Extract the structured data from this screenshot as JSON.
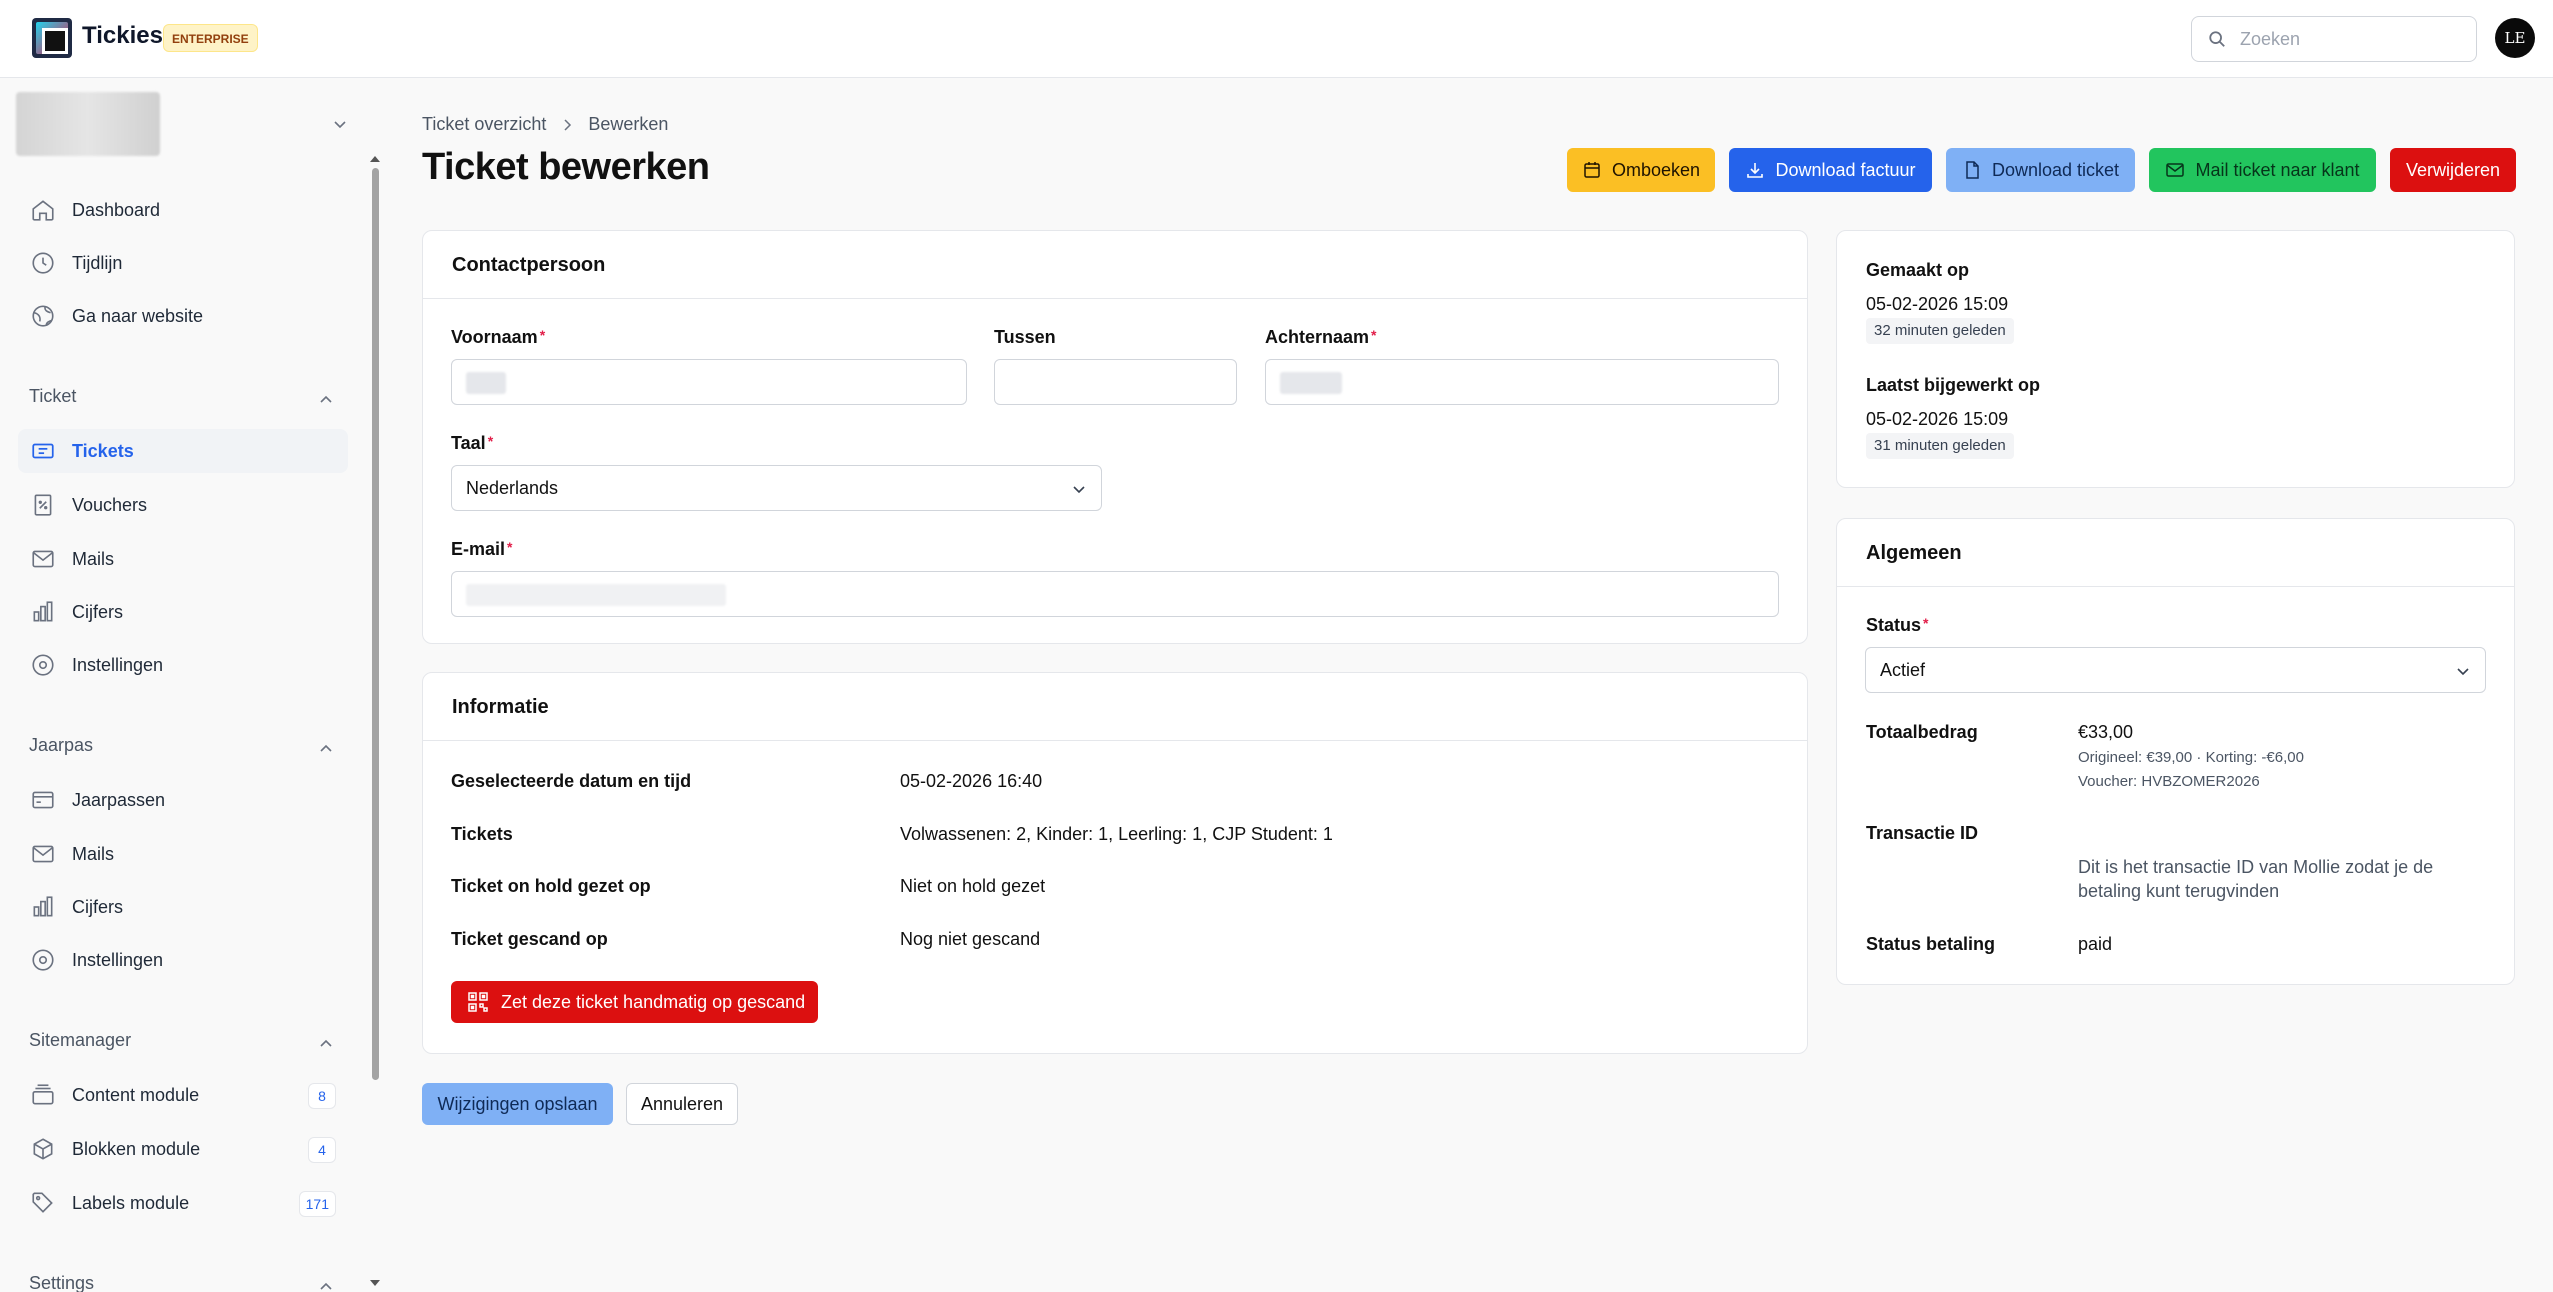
{
  "app": {
    "name": "Tickies",
    "edition_badge": "ENTERPRISE",
    "avatar_initials": "LE"
  },
  "search": {
    "placeholder": "Zoeken"
  },
  "sidebar": {
    "main_items": [
      {
        "label": "Dashboard",
        "icon": "home-icon"
      },
      {
        "label": "Tijdlijn",
        "icon": "clock-icon"
      },
      {
        "label": "Ga naar website",
        "icon": "globe-icon"
      }
    ],
    "sections": [
      {
        "title": "Ticket",
        "items": [
          {
            "label": "Tickets",
            "icon": "ticket-icon",
            "active": true
          },
          {
            "label": "Vouchers",
            "icon": "voucher-icon"
          },
          {
            "label": "Mails",
            "icon": "mail-icon"
          },
          {
            "label": "Cijfers",
            "icon": "bar-chart-icon"
          },
          {
            "label": "Instellingen",
            "icon": "settings-icon"
          }
        ]
      },
      {
        "title": "Jaarpas",
        "items": [
          {
            "label": "Jaarpassen",
            "icon": "card-icon"
          },
          {
            "label": "Mails",
            "icon": "mail-icon"
          },
          {
            "label": "Cijfers",
            "icon": "bar-chart-icon"
          },
          {
            "label": "Instellingen",
            "icon": "settings-icon"
          }
        ]
      },
      {
        "title": "Sitemanager",
        "items": [
          {
            "label": "Content module",
            "icon": "layers-icon",
            "count": "8"
          },
          {
            "label": "Blokken module",
            "icon": "box-icon",
            "count": "4"
          },
          {
            "label": "Labels module",
            "icon": "tag-icon",
            "count": "171"
          }
        ]
      },
      {
        "title": "Settings",
        "items": []
      }
    ]
  },
  "breadcrumb": {
    "parent": "Ticket overzicht",
    "current": "Bewerken"
  },
  "page": {
    "title": "Ticket bewerken"
  },
  "actions": {
    "omboeken": "Omboeken",
    "download_factuur": "Download factuur",
    "download_ticket": "Download ticket",
    "mail_ticket": "Mail ticket naar klant",
    "verwijderen": "Verwijderen"
  },
  "contact": {
    "title": "Contactpersoon",
    "voornaam_label": "Voornaam",
    "tussen_label": "Tussen",
    "achternaam_label": "Achternaam",
    "taal_label": "Taal",
    "taal_value": "Nederlands",
    "email_label": "E-mail",
    "required_mark": "*"
  },
  "info": {
    "title": "Informatie",
    "rows": [
      {
        "label": "Geselecteerde datum en tijd",
        "value": "05-02-2026 16:40"
      },
      {
        "label": "Tickets",
        "value": "Volwassenen: 2, Kinder: 1, Leerling: 1, CJP Student: 1"
      },
      {
        "label": "Ticket on hold gezet op",
        "value": "Niet on hold gezet"
      },
      {
        "label": "Ticket gescand op",
        "value": "Nog niet gescand"
      }
    ],
    "scan_button": "Zet deze ticket handmatig op gescand"
  },
  "form_actions": {
    "save": "Wijzigingen opslaan",
    "cancel": "Annuleren"
  },
  "meta": {
    "created_label": "Gemaakt op",
    "created_value": "05-02-2026 15:09",
    "created_ago": "32 minuten geleden",
    "updated_label": "Laatst bijgewerkt op",
    "updated_value": "05-02-2026 15:09",
    "updated_ago": "31 minuten geleden"
  },
  "general": {
    "title": "Algemeen",
    "status_label": "Status",
    "status_value": "Actief",
    "total_label": "Totaalbedrag",
    "total_value": "€33,00",
    "total_detail": "Origineel: €39,00 · Korting: -€6,00",
    "voucher_detail": "Voucher: HVBZOMER2026",
    "transaction_label": "Transactie ID",
    "transaction_help": "Dit is het transactie ID van Mollie zodat je de betaling kunt terugvinden",
    "payment_status_label": "Status betaling",
    "payment_status_value": "paid"
  },
  "colors": {
    "primary": "#2563eb",
    "danger": "#dc1010",
    "warning": "#fbbf24",
    "success": "#22c55e",
    "light_primary": "#7fb0f5"
  }
}
